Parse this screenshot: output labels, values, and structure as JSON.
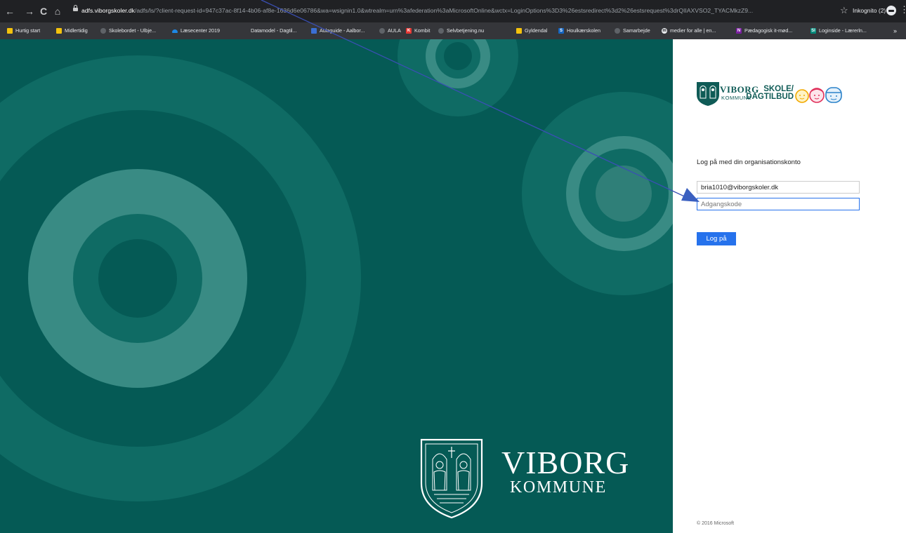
{
  "browser": {
    "nav": {
      "back": "←",
      "forward": "→",
      "reload": "C",
      "home": "⌂"
    },
    "address": {
      "host": "adfs.viborgskoler.dk",
      "path": "/adfs/ls/?client-request-id=947c37ac-8f14-4b06-af8e-1636d6e06786&wa=wsignin1.0&wtrealm=urn%3afederation%3aMicrosoftOnline&wctx=LoginOptions%3D3%26estsredirect%3d2%26estsrequest%3drQIIAXVSO2_TYACMkzZ9..."
    },
    "star": "☆",
    "incognito_label": "Inkognito (2)",
    "menu": "⋮"
  },
  "bookmarks": {
    "items": [
      {
        "label": "Hurtig start",
        "icon": "folder-icon",
        "color": "#f4c20d"
      },
      {
        "label": "Midlertidig",
        "icon": "folder-icon",
        "color": "#f4c20d"
      },
      {
        "label": "Skolebordet - Ulbje...",
        "icon": "globe-icon",
        "color": "#5f6368"
      },
      {
        "label": "Læsecenter 2019",
        "icon": "cloud-icon",
        "color": "#1e88e5"
      },
      {
        "label": "Datamodel - Dagtil...",
        "icon": "blank-icon",
        "color": "#35363a"
      },
      {
        "label": "Aulaguide - Aalbor...",
        "icon": "doc-icon",
        "color": "#3b6fd4"
      },
      {
        "label": "AULA",
        "icon": "globe-icon",
        "color": "#5f6368"
      },
      {
        "label": "Kombit",
        "icon": "kombit-icon",
        "color": "#e53935"
      },
      {
        "label": "Selvbetjening.nu",
        "icon": "globe-icon",
        "color": "#5f6368"
      },
      {
        "label": "Gyldendal",
        "icon": "folder-icon",
        "color": "#f4c20d"
      },
      {
        "label": "Houlkærskolen",
        "icon": "sharepoint-icon",
        "color": "#1565c0"
      },
      {
        "label": "Samarbejde",
        "icon": "globe-icon",
        "color": "#5f6368"
      },
      {
        "label": "medier for alle | en...",
        "icon": "media-icon",
        "color": "#202124"
      },
      {
        "label": "Pædagogisk it-mød...",
        "icon": "onenote-icon",
        "color": "#7b1fa2"
      },
      {
        "label": "Loginside - Lærerln...",
        "icon": "si-icon",
        "color": "#00897b"
      }
    ],
    "more": "»"
  },
  "hero": {
    "brand_name": "VIBORG",
    "brand_sub": "KOMMUNE"
  },
  "panel": {
    "logo": {
      "name": "VIBORG",
      "sub": "KOMMUNE",
      "skole_line1": "SKOLE/",
      "skole_line2": "DAGTILBUD"
    },
    "heading": "Log på med din organisationskonto",
    "username_value": "bria1010@viborgskoler.dk",
    "password_placeholder": "Adgangskode",
    "submit_label": "Log på",
    "copyright": "© 2016 Microsoft"
  },
  "colors": {
    "hero_bg": "#055a55",
    "accent_blue": "#2672ec",
    "brand_teal": "#0f5b56",
    "chrome_dark": "#202124"
  }
}
